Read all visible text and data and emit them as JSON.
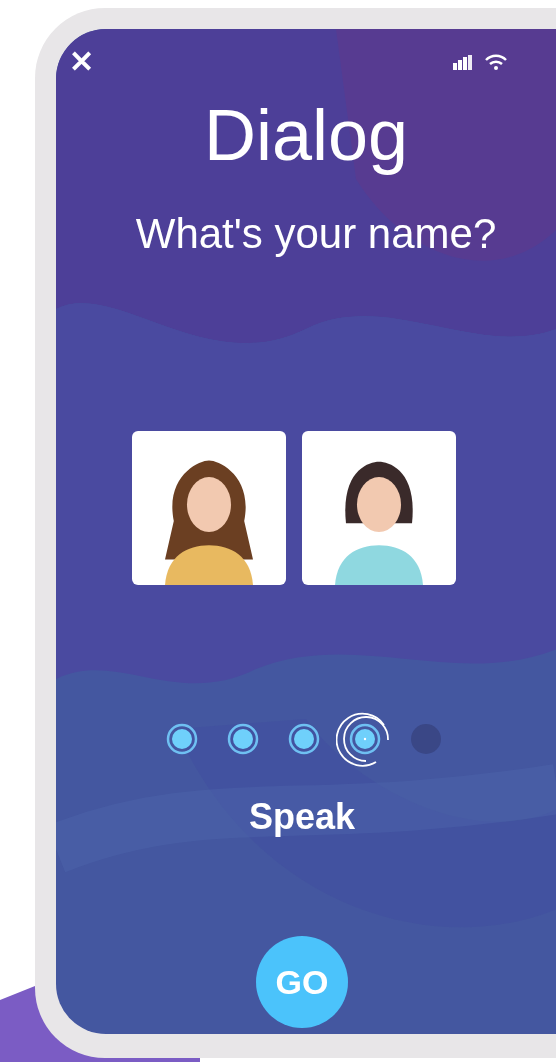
{
  "header": {
    "close": "✕"
  },
  "title": "Dialog",
  "question": "What's your name?",
  "speakers": [
    {
      "kind": "curly"
    },
    {
      "kind": "bob"
    }
  ],
  "steps": [
    {
      "kind": "done"
    },
    {
      "kind": "done"
    },
    {
      "kind": "done"
    },
    {
      "kind": "current"
    },
    {
      "kind": "pending"
    }
  ],
  "step_label": "Speak",
  "go_button": "GO"
}
